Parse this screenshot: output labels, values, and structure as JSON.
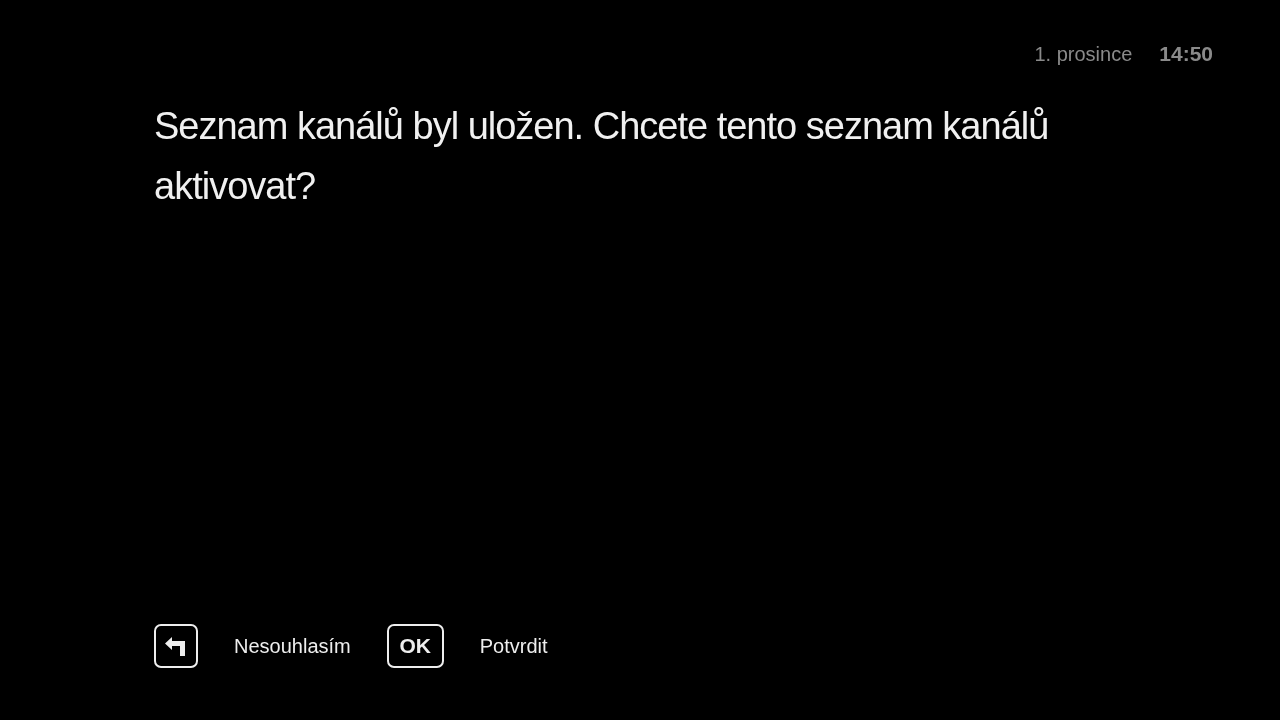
{
  "header": {
    "date": "1. prosince",
    "time": "14:50"
  },
  "message": "Seznam kanálů byl uložen. Chcete tento seznam kanálů aktivovat?",
  "hints": [
    {
      "kind": "back",
      "label": "Nesouhlasím"
    },
    {
      "kind": "key",
      "key": "OK",
      "label": "Potvrdit"
    }
  ]
}
